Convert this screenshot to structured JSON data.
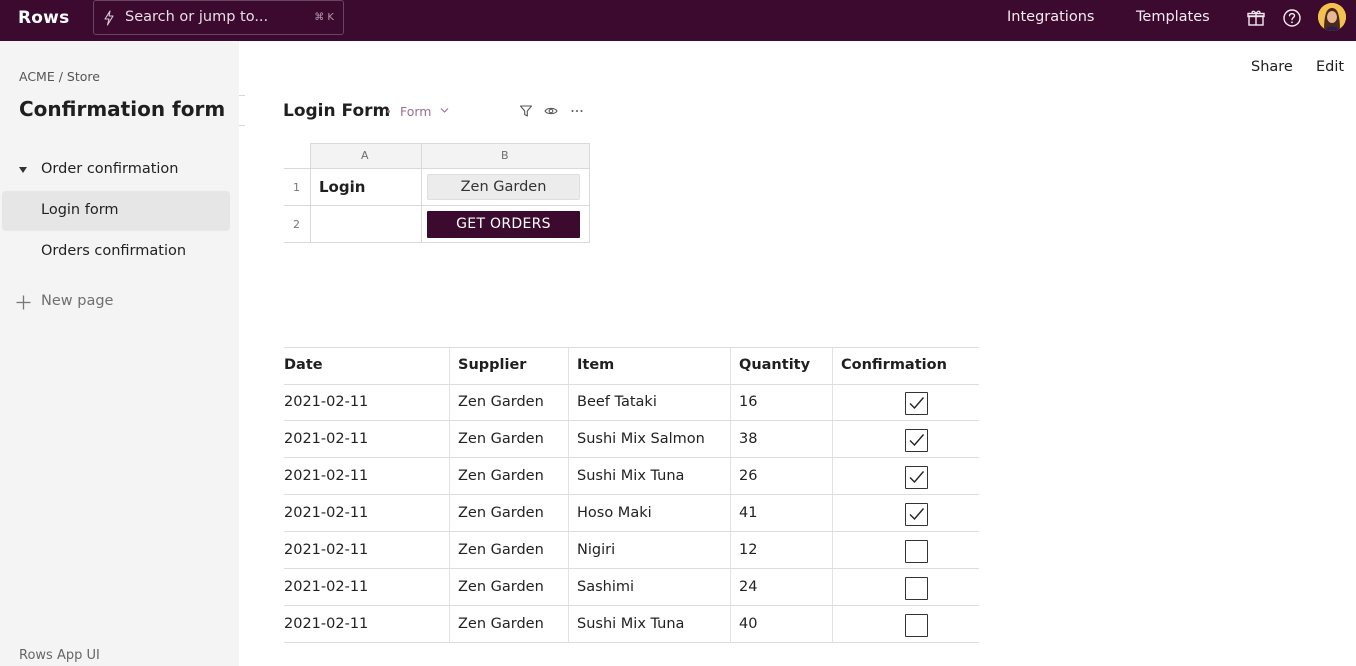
{
  "topbar": {
    "logo": "Rows",
    "search_placeholder": "Search or jump to...",
    "search_shortcut": "⌘ K",
    "nav": [
      "Integrations",
      "Templates"
    ],
    "bg_color": "#3b0a2e"
  },
  "sidebar": {
    "breadcrumb": "ACME / Store",
    "doc_title": "Confirmation form",
    "section": "Order confirmation",
    "pages": [
      "Login form",
      "Orders confirmation"
    ],
    "selected_page": "Login form",
    "new_page": "New page",
    "footer": "Rows App UI"
  },
  "header": {
    "share": "Share",
    "edit": "Edit"
  },
  "form": {
    "title": "Login Form",
    "kind": "Form",
    "columns": [
      "A",
      "B"
    ],
    "rows": [
      "1",
      "2"
    ],
    "login_label": "Login",
    "login_value": "Zen Garden",
    "button_label": "GET ORDERS"
  },
  "orders": {
    "columns": [
      "Date",
      "Supplier",
      "Item",
      "Quantity",
      "Confirmation"
    ],
    "rows": [
      {
        "date": "2021-02-11",
        "supplier": "Zen Garden",
        "item": "Beef Tataki",
        "quantity": "16",
        "confirmed": true
      },
      {
        "date": "2021-02-11",
        "supplier": "Zen Garden",
        "item": "Sushi Mix Salmon",
        "quantity": "38",
        "confirmed": true
      },
      {
        "date": "2021-02-11",
        "supplier": "Zen Garden",
        "item": "Sushi Mix Tuna",
        "quantity": "26",
        "confirmed": true
      },
      {
        "date": "2021-02-11",
        "supplier": "Zen Garden",
        "item": "Hoso Maki",
        "quantity": "41",
        "confirmed": true
      },
      {
        "date": "2021-02-11",
        "supplier": "Zen Garden",
        "item": "Nigiri",
        "quantity": "12",
        "confirmed": false
      },
      {
        "date": "2021-02-11",
        "supplier": "Zen Garden",
        "item": "Sashimi",
        "quantity": "24",
        "confirmed": false
      },
      {
        "date": "2021-02-11",
        "supplier": "Zen Garden",
        "item": "Sushi Mix Tuna",
        "quantity": "40",
        "confirmed": false
      }
    ]
  }
}
